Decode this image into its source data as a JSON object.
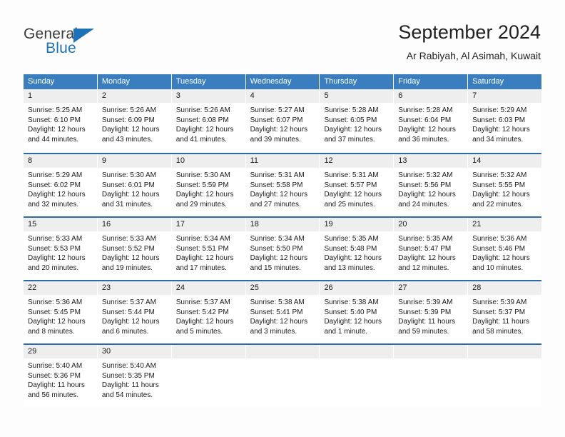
{
  "logo": {
    "primary_text": "General",
    "secondary_text": "Blue",
    "primary_color": "#3b3b3b",
    "accent_color": "#1b72b8",
    "triangle_icon": "logo-triangle-icon"
  },
  "header": {
    "title": "September 2024",
    "subtitle": "Ar Rabiyah, Al Asimah, Kuwait"
  },
  "theme": {
    "header_bg": "#3a7ebf",
    "row_divider": "#2b6ca8",
    "day_number_bg": "#eeeeee",
    "page_bg": "#fdfdfd",
    "text": "#1a1a1a"
  },
  "calendar": {
    "weekdays": [
      "Sunday",
      "Monday",
      "Tuesday",
      "Wednesday",
      "Thursday",
      "Friday",
      "Saturday"
    ],
    "weeks": [
      [
        {
          "day": "1",
          "sunrise": "Sunrise: 5:25 AM",
          "sunset": "Sunset: 6:10 PM",
          "daylight_1": "Daylight: 12 hours",
          "daylight_2": "and 44 minutes."
        },
        {
          "day": "2",
          "sunrise": "Sunrise: 5:26 AM",
          "sunset": "Sunset: 6:09 PM",
          "daylight_1": "Daylight: 12 hours",
          "daylight_2": "and 43 minutes."
        },
        {
          "day": "3",
          "sunrise": "Sunrise: 5:26 AM",
          "sunset": "Sunset: 6:08 PM",
          "daylight_1": "Daylight: 12 hours",
          "daylight_2": "and 41 minutes."
        },
        {
          "day": "4",
          "sunrise": "Sunrise: 5:27 AM",
          "sunset": "Sunset: 6:07 PM",
          "daylight_1": "Daylight: 12 hours",
          "daylight_2": "and 39 minutes."
        },
        {
          "day": "5",
          "sunrise": "Sunrise: 5:28 AM",
          "sunset": "Sunset: 6:05 PM",
          "daylight_1": "Daylight: 12 hours",
          "daylight_2": "and 37 minutes."
        },
        {
          "day": "6",
          "sunrise": "Sunrise: 5:28 AM",
          "sunset": "Sunset: 6:04 PM",
          "daylight_1": "Daylight: 12 hours",
          "daylight_2": "and 36 minutes."
        },
        {
          "day": "7",
          "sunrise": "Sunrise: 5:29 AM",
          "sunset": "Sunset: 6:03 PM",
          "daylight_1": "Daylight: 12 hours",
          "daylight_2": "and 34 minutes."
        }
      ],
      [
        {
          "day": "8",
          "sunrise": "Sunrise: 5:29 AM",
          "sunset": "Sunset: 6:02 PM",
          "daylight_1": "Daylight: 12 hours",
          "daylight_2": "and 32 minutes."
        },
        {
          "day": "9",
          "sunrise": "Sunrise: 5:30 AM",
          "sunset": "Sunset: 6:01 PM",
          "daylight_1": "Daylight: 12 hours",
          "daylight_2": "and 31 minutes."
        },
        {
          "day": "10",
          "sunrise": "Sunrise: 5:30 AM",
          "sunset": "Sunset: 5:59 PM",
          "daylight_1": "Daylight: 12 hours",
          "daylight_2": "and 29 minutes."
        },
        {
          "day": "11",
          "sunrise": "Sunrise: 5:31 AM",
          "sunset": "Sunset: 5:58 PM",
          "daylight_1": "Daylight: 12 hours",
          "daylight_2": "and 27 minutes."
        },
        {
          "day": "12",
          "sunrise": "Sunrise: 5:31 AM",
          "sunset": "Sunset: 5:57 PM",
          "daylight_1": "Daylight: 12 hours",
          "daylight_2": "and 25 minutes."
        },
        {
          "day": "13",
          "sunrise": "Sunrise: 5:32 AM",
          "sunset": "Sunset: 5:56 PM",
          "daylight_1": "Daylight: 12 hours",
          "daylight_2": "and 24 minutes."
        },
        {
          "day": "14",
          "sunrise": "Sunrise: 5:32 AM",
          "sunset": "Sunset: 5:55 PM",
          "daylight_1": "Daylight: 12 hours",
          "daylight_2": "and 22 minutes."
        }
      ],
      [
        {
          "day": "15",
          "sunrise": "Sunrise: 5:33 AM",
          "sunset": "Sunset: 5:53 PM",
          "daylight_1": "Daylight: 12 hours",
          "daylight_2": "and 20 minutes."
        },
        {
          "day": "16",
          "sunrise": "Sunrise: 5:33 AM",
          "sunset": "Sunset: 5:52 PM",
          "daylight_1": "Daylight: 12 hours",
          "daylight_2": "and 19 minutes."
        },
        {
          "day": "17",
          "sunrise": "Sunrise: 5:34 AM",
          "sunset": "Sunset: 5:51 PM",
          "daylight_1": "Daylight: 12 hours",
          "daylight_2": "and 17 minutes."
        },
        {
          "day": "18",
          "sunrise": "Sunrise: 5:34 AM",
          "sunset": "Sunset: 5:50 PM",
          "daylight_1": "Daylight: 12 hours",
          "daylight_2": "and 15 minutes."
        },
        {
          "day": "19",
          "sunrise": "Sunrise: 5:35 AM",
          "sunset": "Sunset: 5:48 PM",
          "daylight_1": "Daylight: 12 hours",
          "daylight_2": "and 13 minutes."
        },
        {
          "day": "20",
          "sunrise": "Sunrise: 5:35 AM",
          "sunset": "Sunset: 5:47 PM",
          "daylight_1": "Daylight: 12 hours",
          "daylight_2": "and 12 minutes."
        },
        {
          "day": "21",
          "sunrise": "Sunrise: 5:36 AM",
          "sunset": "Sunset: 5:46 PM",
          "daylight_1": "Daylight: 12 hours",
          "daylight_2": "and 10 minutes."
        }
      ],
      [
        {
          "day": "22",
          "sunrise": "Sunrise: 5:36 AM",
          "sunset": "Sunset: 5:45 PM",
          "daylight_1": "Daylight: 12 hours",
          "daylight_2": "and 8 minutes."
        },
        {
          "day": "23",
          "sunrise": "Sunrise: 5:37 AM",
          "sunset": "Sunset: 5:44 PM",
          "daylight_1": "Daylight: 12 hours",
          "daylight_2": "and 6 minutes."
        },
        {
          "day": "24",
          "sunrise": "Sunrise: 5:37 AM",
          "sunset": "Sunset: 5:42 PM",
          "daylight_1": "Daylight: 12 hours",
          "daylight_2": "and 5 minutes."
        },
        {
          "day": "25",
          "sunrise": "Sunrise: 5:38 AM",
          "sunset": "Sunset: 5:41 PM",
          "daylight_1": "Daylight: 12 hours",
          "daylight_2": "and 3 minutes."
        },
        {
          "day": "26",
          "sunrise": "Sunrise: 5:38 AM",
          "sunset": "Sunset: 5:40 PM",
          "daylight_1": "Daylight: 12 hours",
          "daylight_2": "and 1 minute."
        },
        {
          "day": "27",
          "sunrise": "Sunrise: 5:39 AM",
          "sunset": "Sunset: 5:39 PM",
          "daylight_1": "Daylight: 11 hours",
          "daylight_2": "and 59 minutes."
        },
        {
          "day": "28",
          "sunrise": "Sunrise: 5:39 AM",
          "sunset": "Sunset: 5:37 PM",
          "daylight_1": "Daylight: 11 hours",
          "daylight_2": "and 58 minutes."
        }
      ],
      [
        {
          "day": "29",
          "sunrise": "Sunrise: 5:40 AM",
          "sunset": "Sunset: 5:36 PM",
          "daylight_1": "Daylight: 11 hours",
          "daylight_2": "and 56 minutes."
        },
        {
          "day": "30",
          "sunrise": "Sunrise: 5:40 AM",
          "sunset": "Sunset: 5:35 PM",
          "daylight_1": "Daylight: 11 hours",
          "daylight_2": "and 54 minutes."
        },
        {
          "day": "",
          "sunrise": "",
          "sunset": "",
          "daylight_1": "",
          "daylight_2": ""
        },
        {
          "day": "",
          "sunrise": "",
          "sunset": "",
          "daylight_1": "",
          "daylight_2": ""
        },
        {
          "day": "",
          "sunrise": "",
          "sunset": "",
          "daylight_1": "",
          "daylight_2": ""
        },
        {
          "day": "",
          "sunrise": "",
          "sunset": "",
          "daylight_1": "",
          "daylight_2": ""
        },
        {
          "day": "",
          "sunrise": "",
          "sunset": "",
          "daylight_1": "",
          "daylight_2": ""
        }
      ]
    ]
  }
}
